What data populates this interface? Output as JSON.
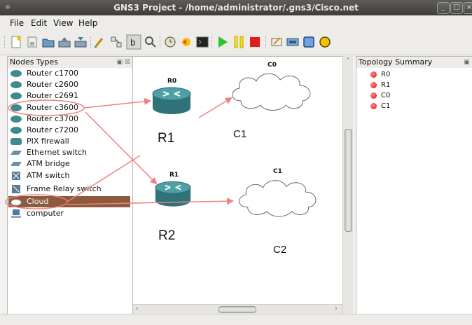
{
  "window": {
    "title": "GNS3 Project - /home/administrator/.gns3/Cisco.net",
    "controls": [
      "_",
      "□",
      "×"
    ]
  },
  "menu": [
    "File",
    "Edit",
    "View",
    "Help"
  ],
  "toolbar_icons": [
    "new-project-icon",
    "save-icon",
    "open-icon",
    "import-icon",
    "export-icon",
    "brush-icon",
    "snapshot-icon",
    "text-icon",
    "search-icon",
    "clock-icon",
    "undo-icon",
    "console-icon",
    "start-icon",
    "pause-icon",
    "stop-icon",
    "note-icon",
    "picture-icon",
    "rectangle-icon",
    "ellipse-icon"
  ],
  "nodes_panel": {
    "title": "Nodes Types",
    "items": [
      {
        "label": "Router c1700",
        "icon": "router-icon"
      },
      {
        "label": "Router c2600",
        "icon": "router-icon"
      },
      {
        "label": "Router c2691",
        "icon": "router-icon"
      },
      {
        "label": "Router c3600",
        "icon": "router-icon"
      },
      {
        "label": "Router c3700",
        "icon": "router-icon"
      },
      {
        "label": "Router c7200",
        "icon": "router-icon"
      },
      {
        "label": "PIX firewall",
        "icon": "firewall-icon"
      },
      {
        "label": "Ethernet switch",
        "icon": "switch-icon"
      },
      {
        "label": "ATM bridge",
        "icon": "bridge-icon"
      },
      {
        "label": "ATM switch",
        "icon": "atm-switch-icon"
      },
      {
        "label": "Frame Relay switch",
        "icon": "frame-relay-icon"
      },
      {
        "label": "Cloud",
        "icon": "cloud-icon",
        "selected": true
      },
      {
        "label": "computer",
        "icon": "computer-icon"
      }
    ]
  },
  "topology": {
    "title": "Topology Summary",
    "items": [
      "R0",
      "R1",
      "C0",
      "C1"
    ]
  },
  "canvas": {
    "router0_label": "R0",
    "router1_label": "R1",
    "cloud0_label": "C0",
    "cloud1_label": "C1",
    "annot_r1": "R1",
    "annot_r2": "R2",
    "annot_c1": "C1",
    "annot_c2": "C2"
  },
  "colors": {
    "annotation": "#f08080",
    "selection": "#8c5a3c",
    "router": "#3f8a8f"
  }
}
